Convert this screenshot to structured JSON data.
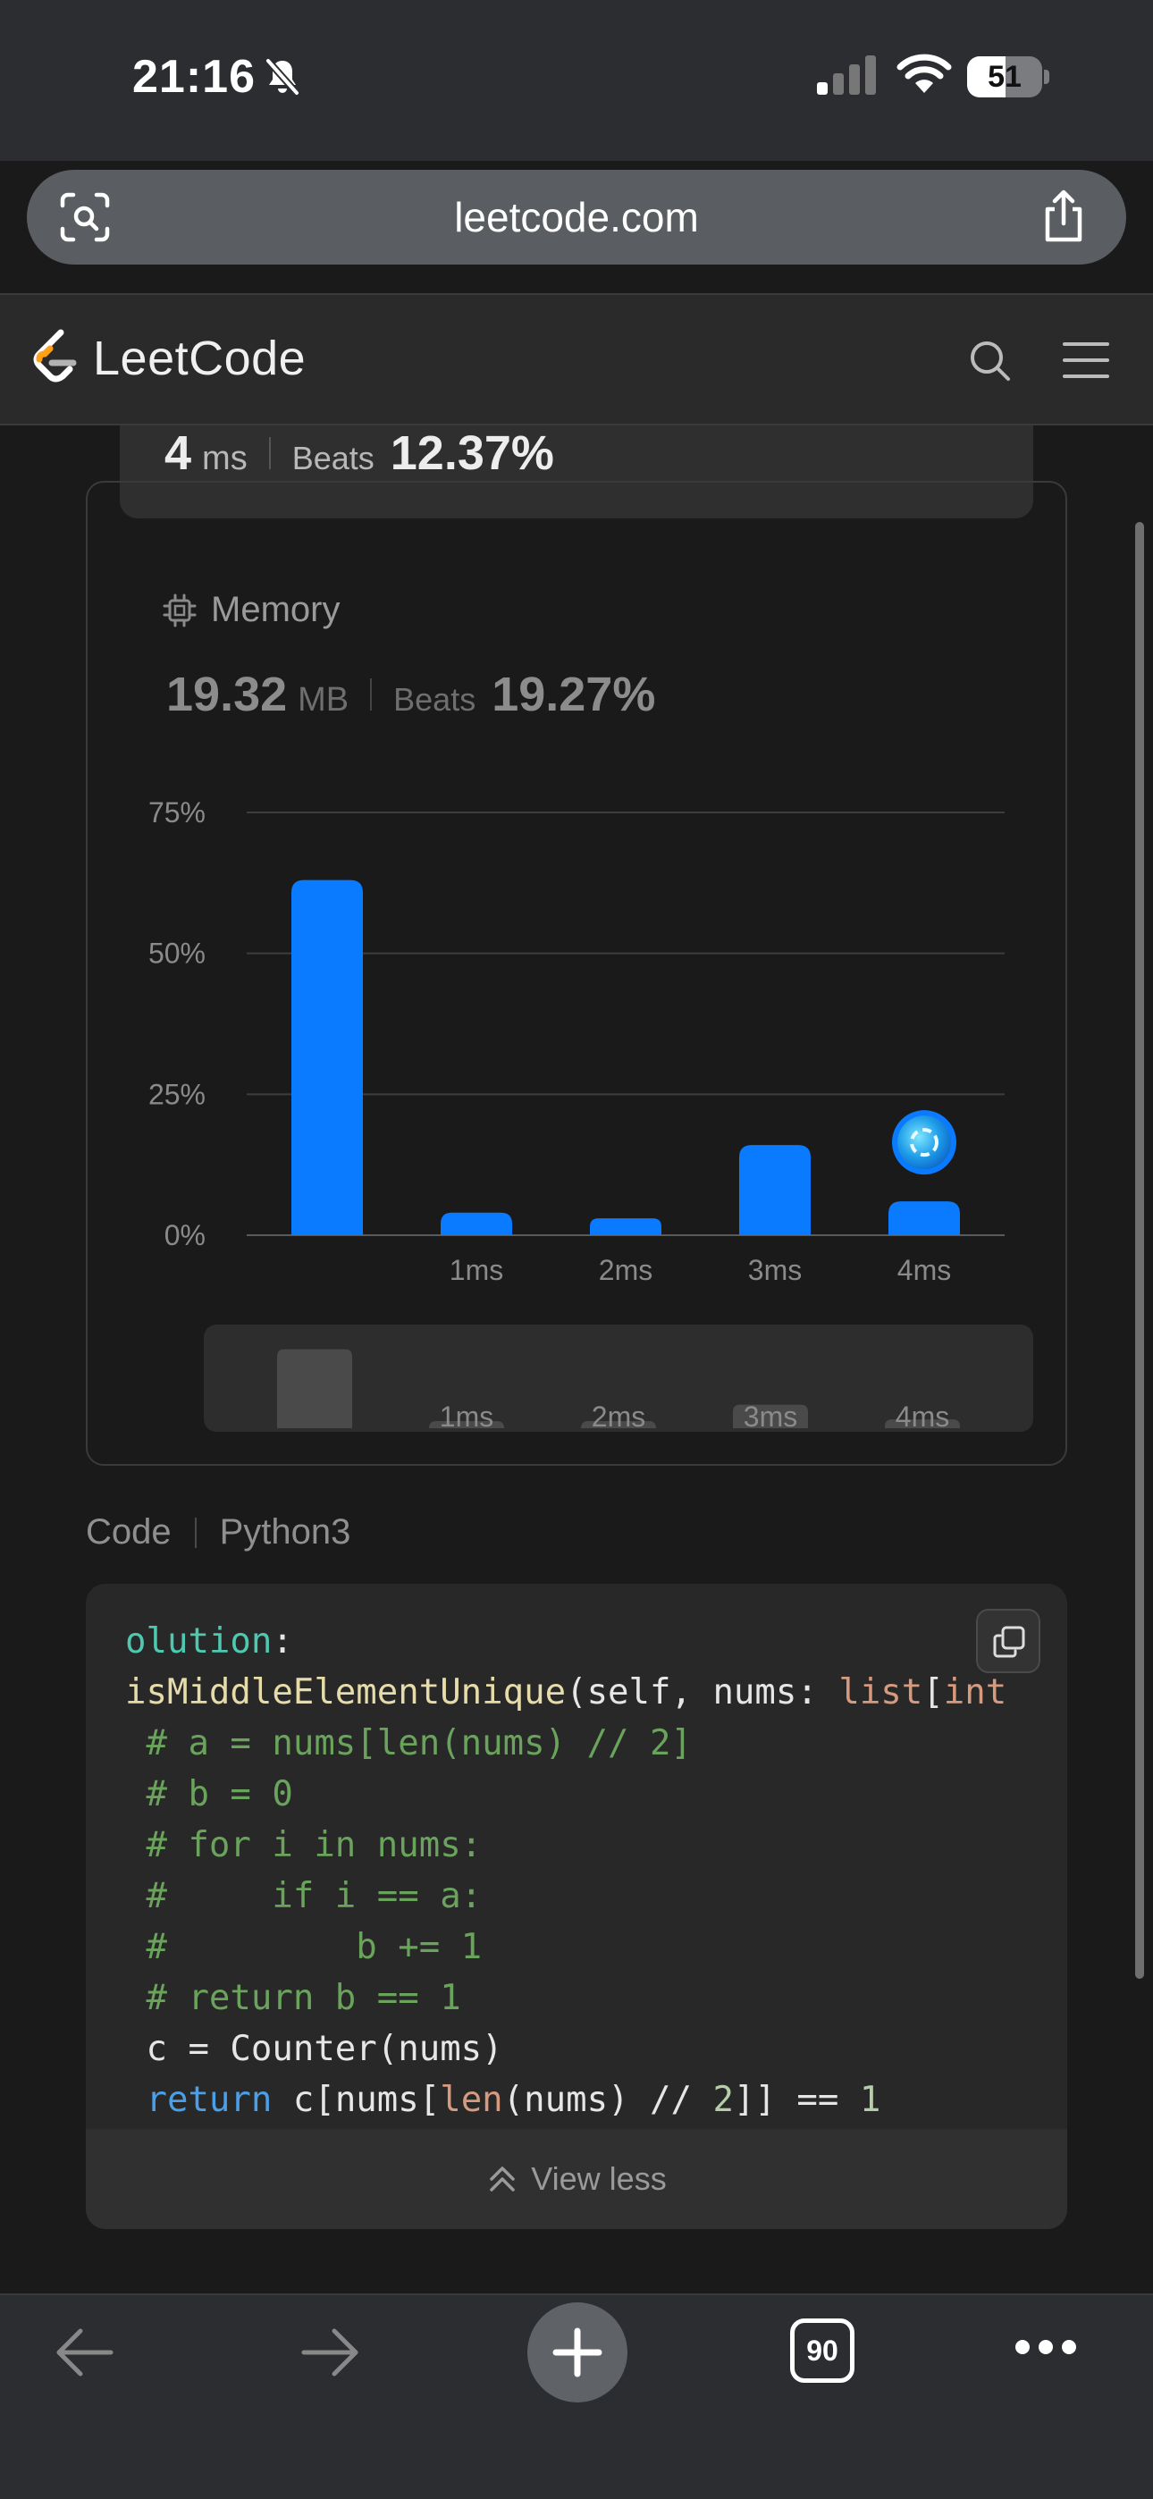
{
  "status_bar": {
    "time": "21:16",
    "battery": "51",
    "battery_level": 0.51
  },
  "browser": {
    "url": "leetcode.com",
    "tab_count": "90"
  },
  "site": {
    "name": "LeetCode"
  },
  "runtime": {
    "value": "4",
    "unit": "ms",
    "beats_label": "Beats",
    "beats_pct": "12.37%"
  },
  "memory": {
    "label": "Memory",
    "value": "19.32",
    "unit": "MB",
    "beats_label": "Beats",
    "beats_pct": "19.27%"
  },
  "chart_data": {
    "type": "bar",
    "categories": [
      "",
      "1ms",
      "2ms",
      "3ms",
      "4ms"
    ],
    "values": [
      63,
      4,
      3,
      16,
      6
    ],
    "y_ticks": [
      "75%",
      "50%",
      "25%",
      "0%"
    ],
    "ylim": [
      0,
      75
    ],
    "grid": true,
    "bar_color": "#0a7aff",
    "highlight_category": "4ms",
    "overview": {
      "categories": [
        "",
        "1ms",
        "2ms",
        "3ms",
        "4ms"
      ],
      "values": [
        63,
        4,
        3,
        16,
        6
      ]
    }
  },
  "code": {
    "title": "Code",
    "language": "Python3",
    "view_less_label": "View less",
    "lines": [
      [
        {
          "t": "olution",
          "c": "cls"
        },
        {
          "t": ":",
          "c": ""
        }
      ],
      [
        {
          "t": "isMiddleElementUnique",
          "c": "fn"
        },
        {
          "t": "(self, nums: ",
          "c": ""
        },
        {
          "t": "list",
          "c": "builtin"
        },
        {
          "t": "[",
          "c": ""
        },
        {
          "t": "int",
          "c": "builtin"
        }
      ],
      [
        {
          "t": " # a = nums[len(nums) // 2]",
          "c": "comment"
        }
      ],
      [
        {
          "t": " # b = 0",
          "c": "comment"
        }
      ],
      [
        {
          "t": " # for i in nums:",
          "c": "comment"
        }
      ],
      [
        {
          "t": " #     if i == a:",
          "c": "comment"
        }
      ],
      [
        {
          "t": " #         b += 1",
          "c": "comment"
        }
      ],
      [
        {
          "t": " # return b == 1",
          "c": "comment"
        }
      ],
      [
        {
          "t": " c = Counter(nums)",
          "c": ""
        }
      ],
      [
        {
          "t": " ",
          "c": ""
        },
        {
          "t": "return",
          "c": "kw"
        },
        {
          "t": " c[nums[",
          "c": ""
        },
        {
          "t": "len",
          "c": "builtin"
        },
        {
          "t": "(nums) // ",
          "c": ""
        },
        {
          "t": "2",
          "c": "num"
        },
        {
          "t": "]] == ",
          "c": ""
        },
        {
          "t": "1",
          "c": "num"
        }
      ]
    ]
  }
}
